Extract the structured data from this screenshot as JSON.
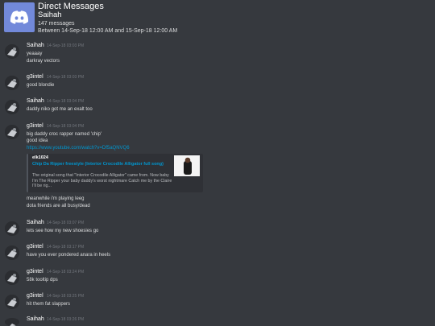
{
  "header": {
    "title": "Direct Messages",
    "channel": "Saihah",
    "count": "147 messages",
    "range": "Between 14-Sep-18 12:00 AM and 15-Sep-18 12:00 AM"
  },
  "colors": {
    "background": "#36393e",
    "discord_blurple": "#7289da",
    "link": "#0096cf",
    "timestamp": "#72767d"
  },
  "messages": [
    {
      "author": "Saihah",
      "timestamp": "14-Sep-18 03:03 PM",
      "lines": [
        "yeaaay",
        "darkray vectors"
      ]
    },
    {
      "author": "g3intel",
      "timestamp": "14-Sep-18 03:03 PM",
      "lines": [
        "good blondie"
      ]
    },
    {
      "author": "Saihah",
      "timestamp": "14-Sep-18 03:04 PM",
      "lines": [
        "daddy niko got me an exalt too"
      ]
    },
    {
      "author": "g3intel",
      "timestamp": "14-Sep-18 03:04 PM",
      "lines": [
        "big daddy croc rapper named 'chip'",
        "good idea"
      ],
      "link": "https://www.youtube.com/watch?v=Df5aQNVQ6",
      "embed": {
        "provider": "elk1024",
        "title": "Chip Da Ripper freestyle (Interior Crocodile Alligator full song)",
        "description": "The original song that \"Interior Crocodile Alligator\" came from. Now baby I'm The Ripper your baby daddy's worst nightmare Catch me by the Claire I'll be rig..."
      },
      "after_lines": [
        "meanwhile i'm playing leeg",
        "dota friends are all busy/dead"
      ]
    },
    {
      "author": "Saihah",
      "timestamp": "14-Sep-18 03:07 PM",
      "lines": [
        "lets see how my new shoesies go"
      ]
    },
    {
      "author": "g3intel",
      "timestamp": "14-Sep-18 03:17 PM",
      "lines": [
        "have you ever pondered anara in heels"
      ]
    },
    {
      "author": "g3intel",
      "timestamp": "14-Sep-18 03:24 PM",
      "lines": [
        "58k tooltip dps"
      ]
    },
    {
      "author": "g3intel",
      "timestamp": "14-Sep-18 03:25 PM",
      "lines": [
        "hit them fat slappers"
      ]
    },
    {
      "author": "Saihah",
      "timestamp": "14-Sep-18 03:26 PM",
      "lines": []
    }
  ]
}
